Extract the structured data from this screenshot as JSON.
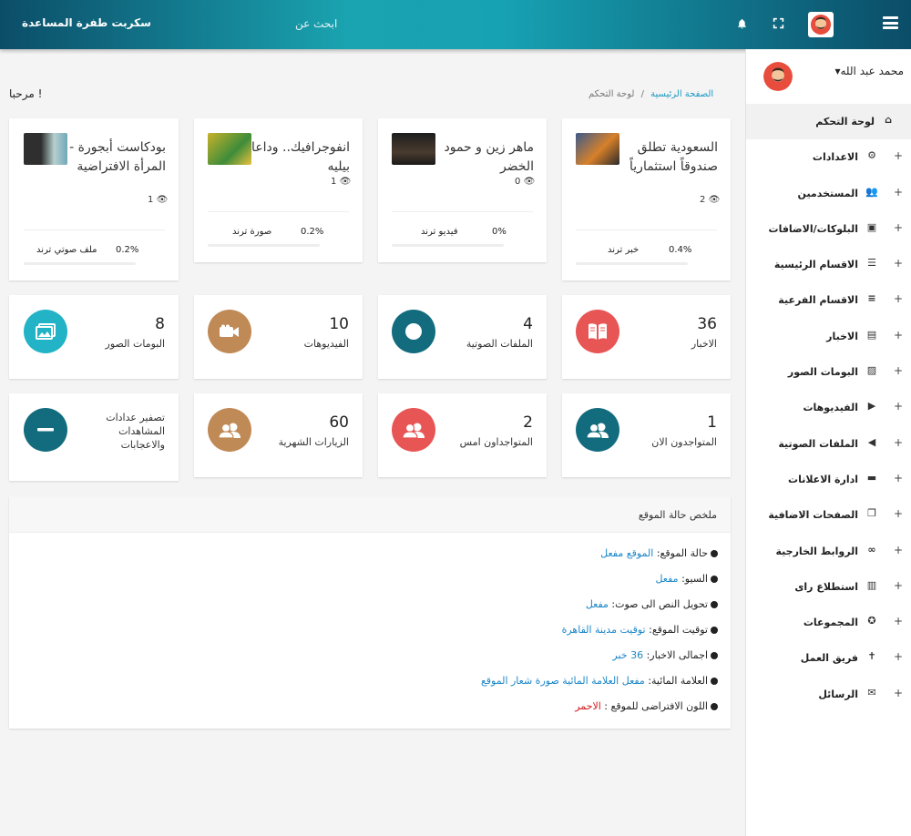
{
  "header": {
    "brand": "سكربت طفرة المساعدة",
    "search_placeholder": "ابحث عن"
  },
  "sidebar": {
    "user_name": "محمد عبد الله",
    "items": [
      {
        "label": "لوحة التحكم",
        "icon": "home-icon",
        "active": true
      },
      {
        "label": "الاعدادات",
        "icon": "gear-icon"
      },
      {
        "label": "المستخدمين",
        "icon": "users-icon"
      },
      {
        "label": "البلوكات/الاضافات",
        "icon": "widget-icon"
      },
      {
        "label": "الاقسام الرئيسية",
        "icon": "list-icon"
      },
      {
        "label": "الاقسام الفرعية",
        "icon": "sublist-icon"
      },
      {
        "label": "الاخبار",
        "icon": "news-icon"
      },
      {
        "label": "البومات الصور",
        "icon": "photo-album-icon"
      },
      {
        "label": "الفيديوهات",
        "icon": "video-icon"
      },
      {
        "label": "الملفات الصوتية",
        "icon": "audio-icon"
      },
      {
        "label": "ادارة الاعلانات",
        "icon": "ads-icon"
      },
      {
        "label": "الصفحات الاضافية",
        "icon": "pages-icon"
      },
      {
        "label": "الروابط الخارجية",
        "icon": "link-icon"
      },
      {
        "label": "استطلاع راى",
        "icon": "poll-icon"
      },
      {
        "label": "المجموعات",
        "icon": "groups-icon"
      },
      {
        "label": "فريق العمل",
        "icon": "team-icon"
      },
      {
        "label": "الرسائل",
        "icon": "mail-icon"
      }
    ]
  },
  "page": {
    "welcome": "مرحبا !",
    "breadcrumb_home": "الصفحة الرئيسية",
    "breadcrumb_sep": "/",
    "breadcrumb_current": "لوحة التحكم"
  },
  "trending": [
    {
      "title": "السعودية تطلق صندوقاً استثمارياً",
      "views": "2",
      "label": "خبر ترند",
      "percent": "0.4%",
      "fraction": 0.004
    },
    {
      "title": "ماهر زين و حمود الخضر",
      "views": "0",
      "label": "فيديو ترند",
      "percent": "0%",
      "fraction": 0
    },
    {
      "title": "انفوجرافيك.. وداعا بيليه",
      "views": "1",
      "label": "صورة ترند",
      "percent": "0.2%",
      "fraction": 0.002
    },
    {
      "title": "بودكاست أبجورة - المرأة الافتراضية",
      "views": "1",
      "label": "ملف صوتي ترند",
      "percent": "0.2%",
      "fraction": 0.002
    }
  ],
  "stats_row1": [
    {
      "value": "36",
      "label": "الاخبار",
      "color": "#e85555",
      "icon": "book-icon"
    },
    {
      "value": "4",
      "label": "الملفات الصوتية",
      "color": "#136c7e",
      "icon": "record-icon"
    },
    {
      "value": "10",
      "label": "الفيديوهات",
      "color": "#c08a56",
      "icon": "video-camera-icon"
    },
    {
      "value": "8",
      "label": "البومات الصور",
      "color": "#22b3c6",
      "icon": "images-icon"
    }
  ],
  "stats_row2": [
    {
      "value": "1",
      "label": "المتواجدون الان",
      "color": "#136c7e",
      "icon": "users-icon"
    },
    {
      "value": "2",
      "label": "المتواجداون امس",
      "color": "#e85555",
      "icon": "users-icon"
    },
    {
      "value": "60",
      "label": "الزيارات الشهرية",
      "color": "#c08a56",
      "icon": "users-icon"
    },
    {
      "value": "",
      "label": "تصفير عدادات المشاهدات والاعجابات",
      "color": "#136c7e",
      "icon": "minus-icon"
    }
  ],
  "summary": {
    "title": "ملخص حالة الموقع",
    "rows": [
      {
        "label": "حالة الموقع:",
        "value": "الموقع مفعل"
      },
      {
        "label": "السيو:",
        "value": "مفعل"
      },
      {
        "label": "تحويل النص الى صوت:",
        "value": "مفعل"
      },
      {
        "label": "توقيت الموقع:",
        "value": "توقيت مدينة القاهرة"
      },
      {
        "label": "اجمالى الاخبار:",
        "value": "36 خبر"
      },
      {
        "label": "العلامة المائية:",
        "value": "مفعل العلامة المائية صورة شعار الموقع"
      },
      {
        "label": "اللون الافتراضى للموقع :",
        "value": "الاحمر"
      }
    ]
  }
}
